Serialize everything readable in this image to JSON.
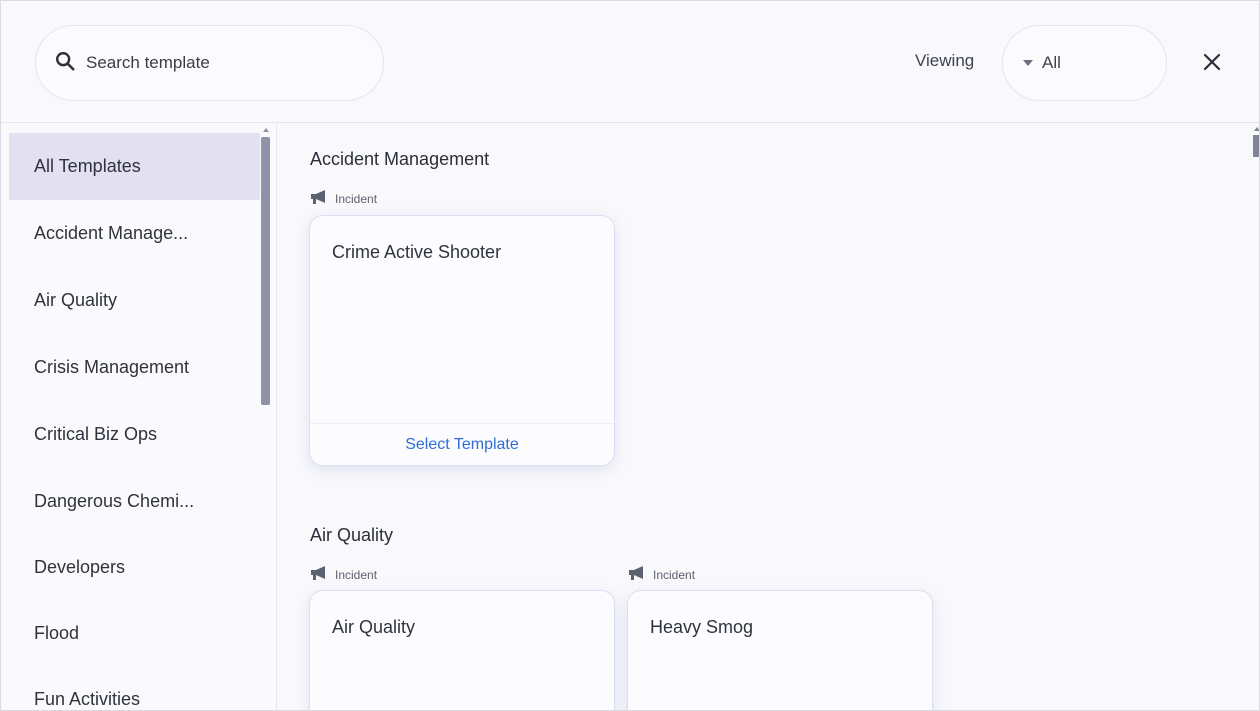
{
  "search": {
    "placeholder": "Search template",
    "icon": "search-icon"
  },
  "filter": {
    "label": "Viewing",
    "selected": "All"
  },
  "close": {
    "icon": "close-icon"
  },
  "sidebar": {
    "items": [
      {
        "label": "All Templates",
        "active": true
      },
      {
        "label": "Accident Manage..."
      },
      {
        "label": "Air Quality"
      },
      {
        "label": "Crisis Management"
      },
      {
        "label": "Critical Biz Ops"
      },
      {
        "label": "Dangerous Chemi..."
      },
      {
        "label": "Developers"
      },
      {
        "label": "Flood"
      },
      {
        "label": "Fun Activities"
      }
    ]
  },
  "sections": [
    {
      "title": "Accident Management",
      "cards": [
        {
          "badge": "Incident",
          "title": "Crime Active Shooter",
          "action": "Select Template"
        }
      ]
    },
    {
      "title": "Air Quality",
      "cards": [
        {
          "badge": "Incident",
          "title": "Air Quality"
        },
        {
          "badge": "Incident",
          "title": "Heavy Smog"
        }
      ]
    }
  ],
  "colors": {
    "accent": "#2f6ed6",
    "active_bg": "#e2e0f1",
    "scrollbar": "#8e93a7"
  }
}
